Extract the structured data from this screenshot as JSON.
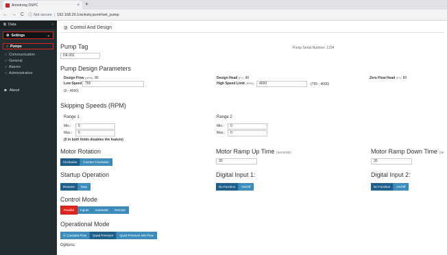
{
  "browser": {
    "tab_title": "Armstrong DSPC",
    "tab_close": "×",
    "new_tab": "+",
    "back": "←",
    "forward": "→",
    "reload": "C",
    "not_secure": "Not secure",
    "url_sep": "|",
    "url": "192.168.20.1/activity.json#/set_pump"
  },
  "sidebar": {
    "data_label": "Data",
    "data_chevron": "‹",
    "settings_label": "Settings",
    "settings_chevron": "⌄",
    "pumps_label": "Pumps",
    "items": [
      {
        "label": "Communication"
      },
      {
        "label": "General"
      },
      {
        "label": "Alarms"
      },
      {
        "label": "Administrative"
      }
    ],
    "about_label": "About"
  },
  "main": {
    "breadcrumb": "Control And Design",
    "pump_tag": {
      "title": "Pump Tag",
      "value": "DE-001"
    },
    "serial_label": "Pump Serial Number: 1234",
    "design_params": {
      "title": "Pump Design Parameters",
      "design_flow": {
        "label": "Design Flow",
        "unit": "(GPM):",
        "value": "85"
      },
      "low_speed": {
        "label": "Low Speed Limit",
        "unit": "(RPM):",
        "value": "765",
        "range": "(0 - 4000)"
      },
      "design_head": {
        "label": "Design Head",
        "unit": "(FT):",
        "value": "80"
      },
      "high_speed": {
        "label": "High Speed Limit",
        "unit": "(RPM):",
        "value": "4000",
        "range": "(765 - 4000)"
      },
      "zero_flow_head": {
        "label": "Zero Flow Head",
        "unit": "(FT):",
        "value": "80"
      }
    },
    "skipping": {
      "title": "Skipping Speeds (RPM)",
      "range1": {
        "title": "Range 1",
        "min_label": "Min.:",
        "min_value": "0",
        "max_label": "Max.:",
        "max_value": "0"
      },
      "range2": {
        "title": "Range 2",
        "min_label": "Min.:",
        "min_value": "0",
        "max_label": "Max.:",
        "max_value": "0"
      },
      "note": "(0 in both fields disables the feature)"
    },
    "motor_rotation": {
      "title": "Motor Rotation",
      "buttons": [
        "Clockwise",
        "Counter Clockwise"
      ]
    },
    "ramp_up": {
      "title": "Motor Ramp Up Time",
      "unit": "(seconds)",
      "value": "30"
    },
    "ramp_down": {
      "title": "Motor Ramp Down Time",
      "unit": "(se",
      "value": "30"
    },
    "startup": {
      "title": "Startup Operation",
      "buttons": [
        "Resume",
        "Stop"
      ]
    },
    "digital1": {
      "title": "Digital Input 1:",
      "buttons": [
        "No Function",
        "On/Off"
      ]
    },
    "digital2": {
      "title": "Digital Input 2:",
      "buttons": [
        "No Function",
        "On/Off"
      ]
    },
    "control_mode": {
      "title": "Control Mode",
      "buttons": [
        "Parallel",
        "Inputs",
        "Automatic",
        "Remote"
      ]
    },
    "operational_mode": {
      "title": "Operational Mode",
      "buttons": [
        "Constant Flow",
        "Quad Pressure",
        "Quad Pressure Min Flow"
      ]
    },
    "options_label": "Options:"
  },
  "colors": {
    "accent": "#3c8dbc",
    "highlight": "#e0241b",
    "sidebar": "#222d32"
  }
}
